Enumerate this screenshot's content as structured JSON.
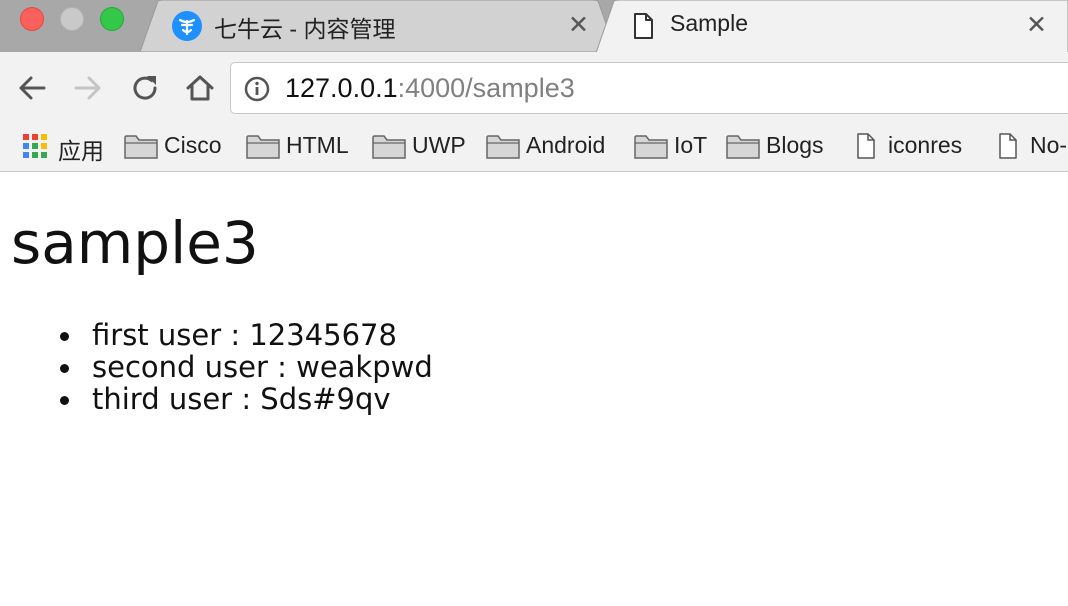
{
  "window": {
    "controls": [
      "close",
      "minimize",
      "maximize"
    ]
  },
  "tabs": [
    {
      "title": "七牛云 - 内容管理",
      "favicon": "qiniu-cloud-icon",
      "active": false
    },
    {
      "title": "Sample",
      "favicon": "document-icon",
      "active": true
    }
  ],
  "toolbar": {
    "back_icon": "back-arrow-icon",
    "forward_icon": "forward-arrow-icon",
    "reload_icon": "reload-icon",
    "home_icon": "home-icon",
    "url_host": "127.0.0.1",
    "url_rest": ":4000/sample3"
  },
  "bookmarks": [
    {
      "label": "应用",
      "icon": "apps-grid-icon"
    },
    {
      "label": "Cisco",
      "icon": "folder-icon"
    },
    {
      "label": "HTML",
      "icon": "folder-icon"
    },
    {
      "label": "UWP",
      "icon": "folder-icon"
    },
    {
      "label": "Android",
      "icon": "folder-icon"
    },
    {
      "label": "IoT",
      "icon": "folder-icon"
    },
    {
      "label": "Blogs",
      "icon": "folder-icon"
    },
    {
      "label": "iconres",
      "icon": "page-icon"
    },
    {
      "label": "No-",
      "icon": "page-icon"
    }
  ],
  "page": {
    "heading": "sample3",
    "items": [
      "first user : 12345678",
      "second user : weakpwd",
      "third user : Sds#9qv"
    ]
  },
  "colors": {
    "tabstrip": "#a8a8a8",
    "toolbar": "#f2f2f2",
    "close_button": "#fc605c",
    "maximize_button": "#34c84a",
    "qiniu_blue": "#1e90ff"
  }
}
